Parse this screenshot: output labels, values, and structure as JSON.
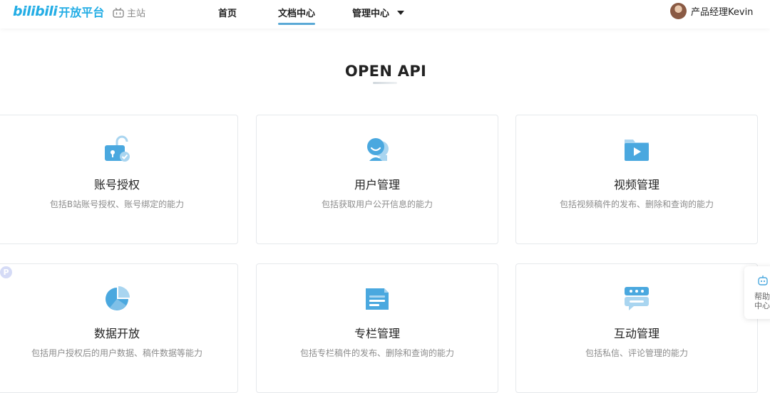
{
  "header": {
    "logo_brand": "bilibili",
    "logo_sub": "开放平台",
    "main_site_label": "主站",
    "nav": [
      {
        "label": "首页"
      },
      {
        "label": "文档中心"
      },
      {
        "label": "管理中心"
      }
    ],
    "user_name": "产品经理Kevin"
  },
  "page": {
    "title": "OPEN API"
  },
  "cards": [
    {
      "title": "账号授权",
      "desc": "包括B站账号授权、账号绑定的能力",
      "icon": "lock-icon"
    },
    {
      "title": "用户管理",
      "desc": "包括获取用户公开信息的能力",
      "icon": "user-icon"
    },
    {
      "title": "视频管理",
      "desc": "包括视频稿件的发布、删除和查询的能力",
      "icon": "video-folder-icon"
    },
    {
      "title": "数据开放",
      "desc": "包括用户授权后的用户数据、稿件数据等能力",
      "icon": "pie-chart-icon"
    },
    {
      "title": "专栏管理",
      "desc": "包括专栏稿件的发布、删除和查询的能力",
      "icon": "article-icon"
    },
    {
      "title": "互动管理",
      "desc": "包括私信、评论管理的能力",
      "icon": "chat-icon"
    }
  ],
  "floating": {
    "badge_letter": "P",
    "help_label": "帮助中心"
  },
  "colors": {
    "accent": "#23ade5",
    "icon_primary": "#4aa8df",
    "icon_light": "#a9d5f0"
  }
}
